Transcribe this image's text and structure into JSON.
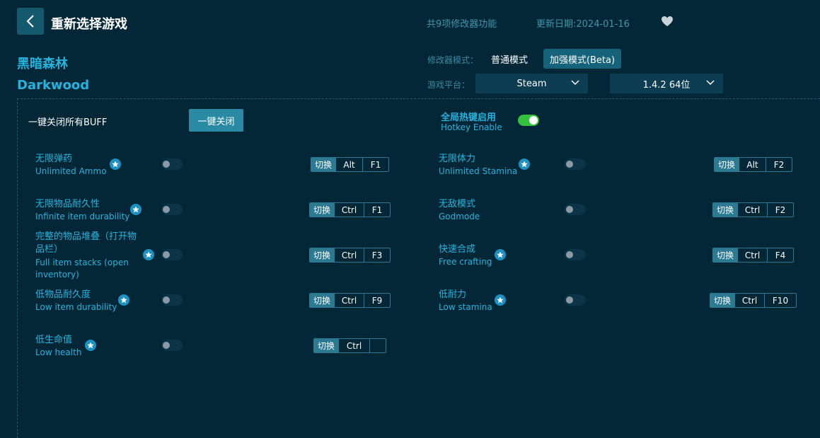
{
  "header": {
    "back_title": "重新选择游戏",
    "feature_count": "共9项修改器功能",
    "update_date": "更新日期:2024-01-16"
  },
  "game": {
    "name_cn": "黑暗森林",
    "name_en": "Darkwood"
  },
  "mode": {
    "label": "修改器模式：",
    "normal": "普通模式",
    "beta": "加强模式(Beta)",
    "selected": "beta"
  },
  "platform": {
    "label": "游戏平台：",
    "value": "Steam",
    "version": "1.4.2 64位"
  },
  "controls": {
    "close_all_label": "一键关闭所有BUFF",
    "close_all_button": "一键关闭",
    "hotkey_cn": "全局热键启用",
    "hotkey_en": "Hotkey Enable",
    "hotkey_enabled": true
  },
  "switch_label": "切换",
  "features": [
    {
      "cn": "无限弹药",
      "en": "Unlimited Ammo",
      "keys": [
        "Alt",
        "F1"
      ],
      "enabled": false
    },
    {
      "cn": "无限体力",
      "en": "Unlimited Stamina",
      "keys": [
        "Alt",
        "F2"
      ],
      "enabled": false
    },
    {
      "cn": "无限物品耐久性",
      "en": "Infinite item durability",
      "keys": [
        "Ctrl",
        "F1"
      ],
      "enabled": false
    },
    {
      "cn": "无敌模式",
      "en": "Godmode",
      "keys": [
        "Ctrl",
        "F2"
      ],
      "enabled": false
    },
    {
      "cn": "完整的物品堆叠（打开物品栏）",
      "en": "Full item stacks (open inventory)",
      "keys": [
        "Ctrl",
        "F3"
      ],
      "enabled": false
    },
    {
      "cn": "快速合成",
      "en": "Free crafting",
      "keys": [
        "Ctrl",
        "F4"
      ],
      "enabled": false
    },
    {
      "cn": "低物品耐久度",
      "en": "Low item durability",
      "keys": [
        "Ctrl",
        "F9"
      ],
      "enabled": false
    },
    {
      "cn": "低耐力",
      "en": "Low stamina",
      "keys": [
        "Ctrl",
        "F10"
      ],
      "enabled": false
    },
    {
      "cn": "低生命值",
      "en": "Low health",
      "keys": [
        "Ctrl",
        ""
      ],
      "enabled": false
    }
  ],
  "colors": {
    "background": "#032737",
    "accent": "#24b4dd",
    "button": "#2b8aa3",
    "toggle_on": "#35c13e"
  }
}
